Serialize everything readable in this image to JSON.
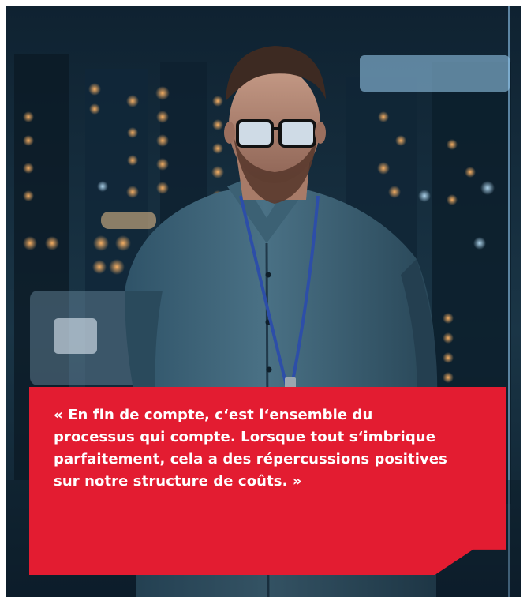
{
  "quote": {
    "lines": [
      "« En fin de compte, c‘est l‘ensemble du",
      "processus qui compte. Lorsque tout s‘imbrique",
      "parfaitement, cela a des répercussions positives",
      "sur notre structure de coûts. »"
    ]
  },
  "colors": {
    "accent": "#e31c31",
    "text": "#ffffff",
    "background": "#13283a"
  },
  "image": {
    "subject": "man-with-glasses-and-lanyard-icon"
  }
}
